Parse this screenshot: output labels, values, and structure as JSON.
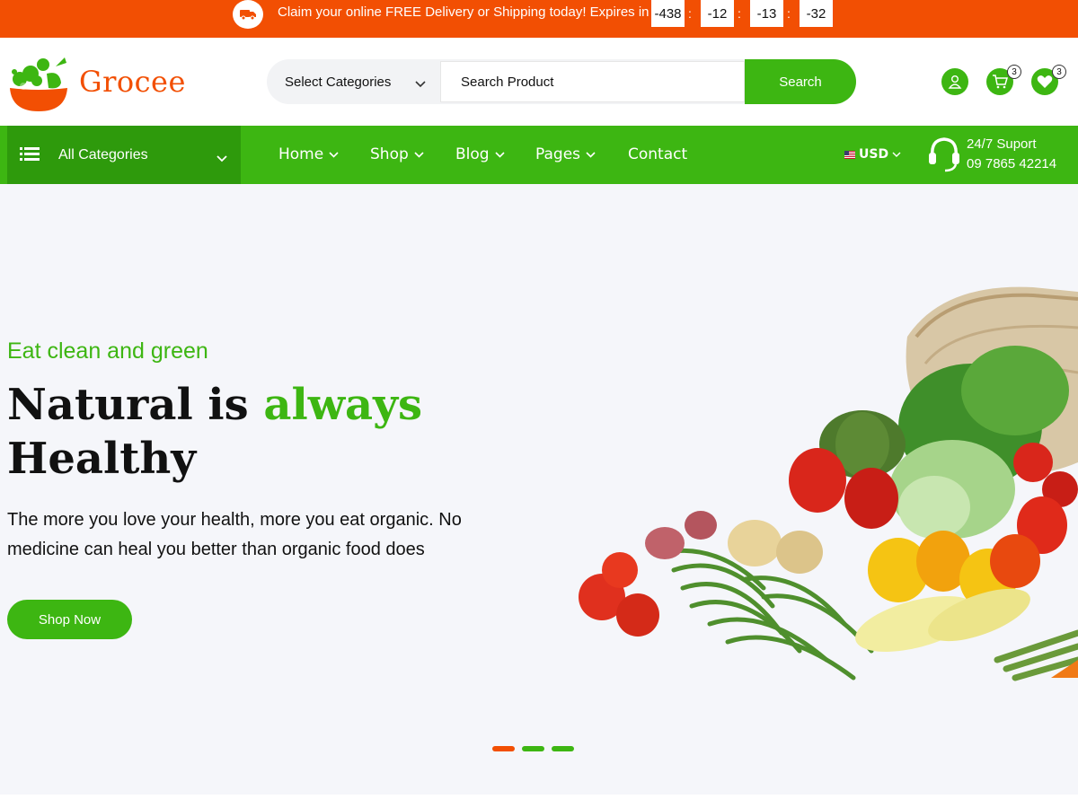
{
  "topbar": {
    "icon": "truck-icon",
    "message": "Claim your online FREE Delivery or Shipping today! Expires in",
    "countdown": [
      "-438",
      "-12",
      "-13",
      "-32"
    ],
    "separator": ":"
  },
  "header": {
    "logo_text": "Grocee",
    "category_select": "Select Categories",
    "search_placeholder": "Search Product",
    "search_button": "Search",
    "account_icon": "user-icon",
    "cart_icon": "cart-icon",
    "cart_count": "3",
    "wishlist_icon": "heart-icon",
    "wishlist_count": "3"
  },
  "nav": {
    "all_categories": "All Categories",
    "menu": [
      "Home",
      "Shop",
      "Blog",
      "Pages",
      "Contact"
    ],
    "currency": "USD",
    "support_title": "24/7 Suport",
    "support_phone": "09 7865 42214"
  },
  "hero": {
    "eyebrow": "Eat clean and green",
    "headline_part1": "Natural is ",
    "headline_highlight": "always",
    "headline_part2": "Healthy",
    "description": "The more you love your health, more you eat organic. No medicine can heal you better than organic food does",
    "cta": "Shop Now",
    "slides": 3,
    "active_slide": 1
  },
  "colors": {
    "orange": "#f24f03",
    "green": "#3db612",
    "dark_green": "#2e9a0c",
    "hero_bg": "#f5f6fa"
  }
}
